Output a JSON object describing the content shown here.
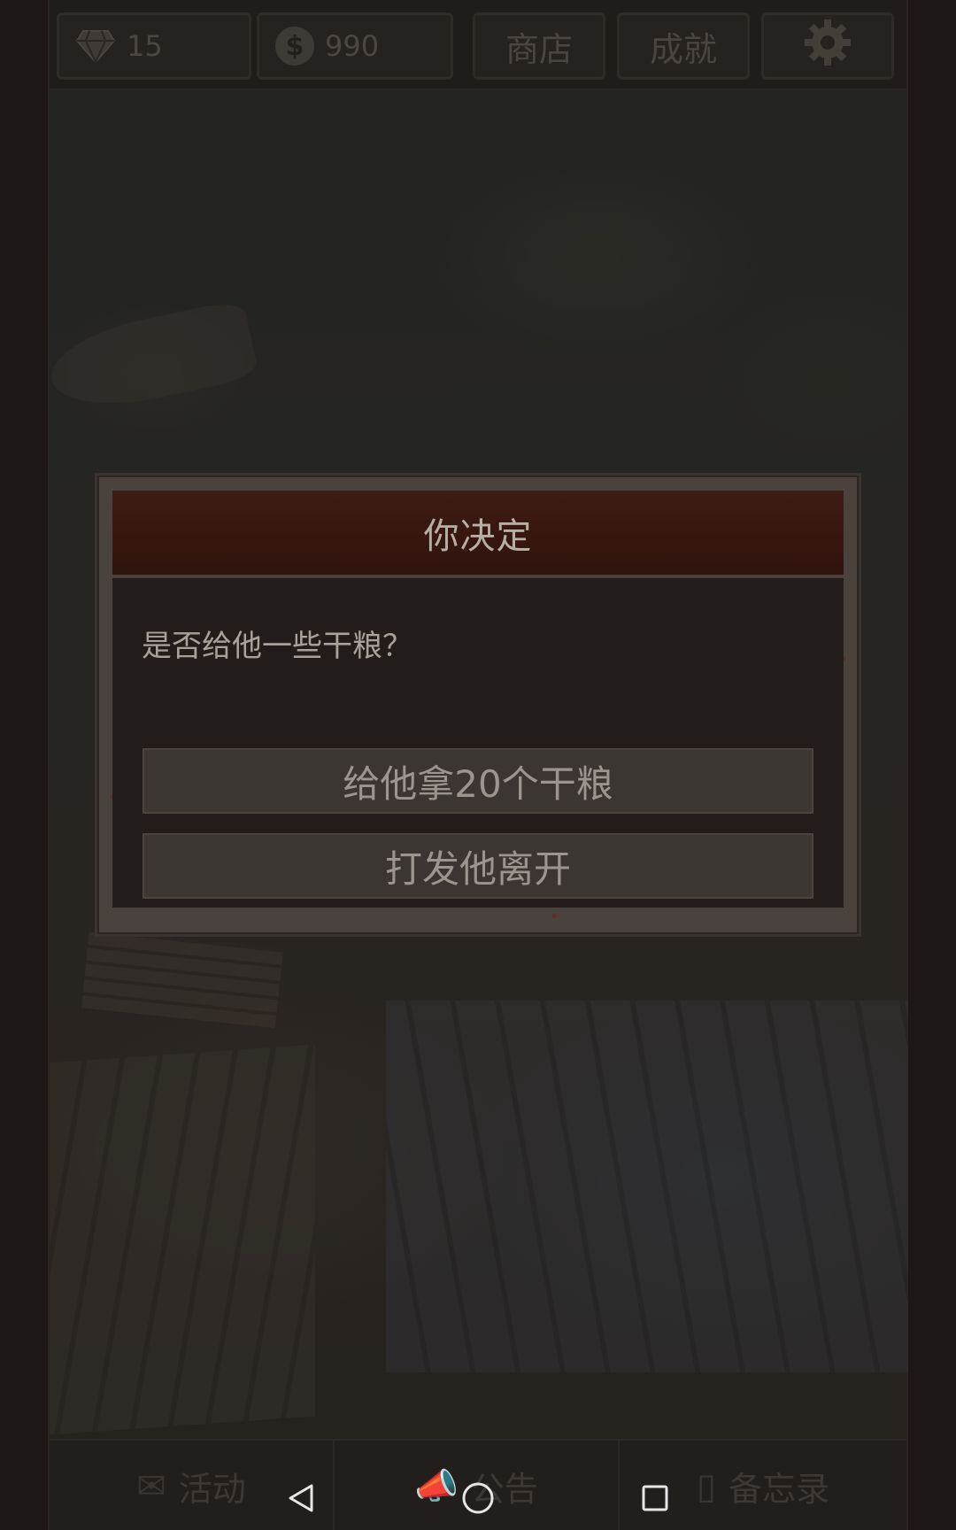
{
  "hud": {
    "gems_value": "15",
    "coins_value": "990",
    "shop_label": "商店",
    "achievements_label": "成就",
    "settings_icon": "gear-icon",
    "gem_icon": "diamond-icon",
    "coin_icon": "dollar-coin-icon",
    "coin_symbol": "$"
  },
  "dialog": {
    "title": "你决定",
    "question": "是否给他一些干粮？",
    "choices": [
      {
        "label": "给他拿20个干粮"
      },
      {
        "label": "打发他离开"
      }
    ]
  },
  "bottom_tabs": [
    {
      "label": "活动",
      "icon": "envelope-icon"
    },
    {
      "label": "公告",
      "icon": "megaphone-icon"
    },
    {
      "label": "备忘录",
      "icon": "notebook-icon"
    }
  ],
  "nav": {
    "back_icon": "back-triangle-icon",
    "home_icon": "home-circle-icon",
    "recents_icon": "recents-square-icon"
  },
  "colors": {
    "dialog_header": "#3d1c16",
    "dialog_body": "#221d1a",
    "button_bg": "#3c3632",
    "text_light": "#b6afa6"
  }
}
